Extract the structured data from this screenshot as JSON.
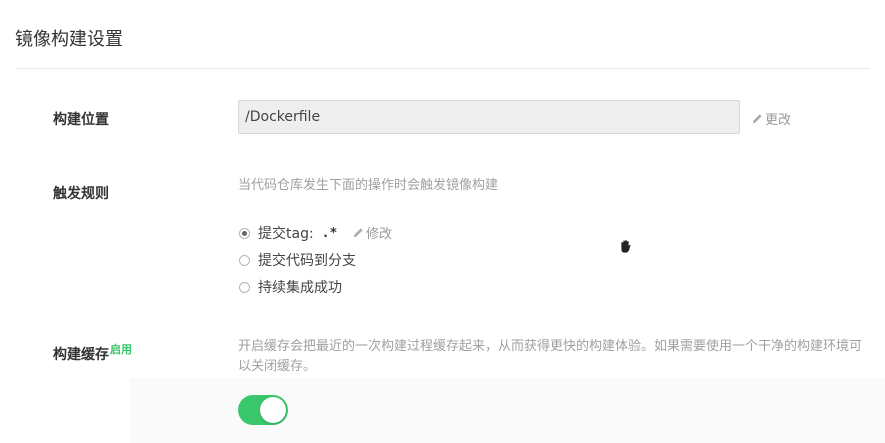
{
  "section": {
    "title": "镜像构建设置"
  },
  "build_location": {
    "label": "构建位置",
    "path_value": "/Dockerfile",
    "edit_label": "更改"
  },
  "trigger": {
    "label": "触发规则",
    "help": "当代码仓库发生下面的操作时会触发镜像构建",
    "options": [
      {
        "label": "提交tag:",
        "selected": true,
        "pattern": ".*",
        "edit_label": "修改"
      },
      {
        "label": "提交代码到分支",
        "selected": false
      },
      {
        "label": "持续集成成功",
        "selected": false
      }
    ]
  },
  "cache": {
    "label": "构建缓存",
    "badge": "启用",
    "help": "开启缓存会把最近的一次构建过程缓存起来，从而获得更快的构建体验。如果需要使用一个干净的构建环境可以关闭缓存。",
    "enabled": true
  },
  "colors": {
    "accent_green": "#3ac66a",
    "muted_text": "#a0a0a0",
    "input_bg": "#eeeeee"
  },
  "icons": {
    "edit": "pencil-icon",
    "cursor": "hand-cursor-icon"
  }
}
